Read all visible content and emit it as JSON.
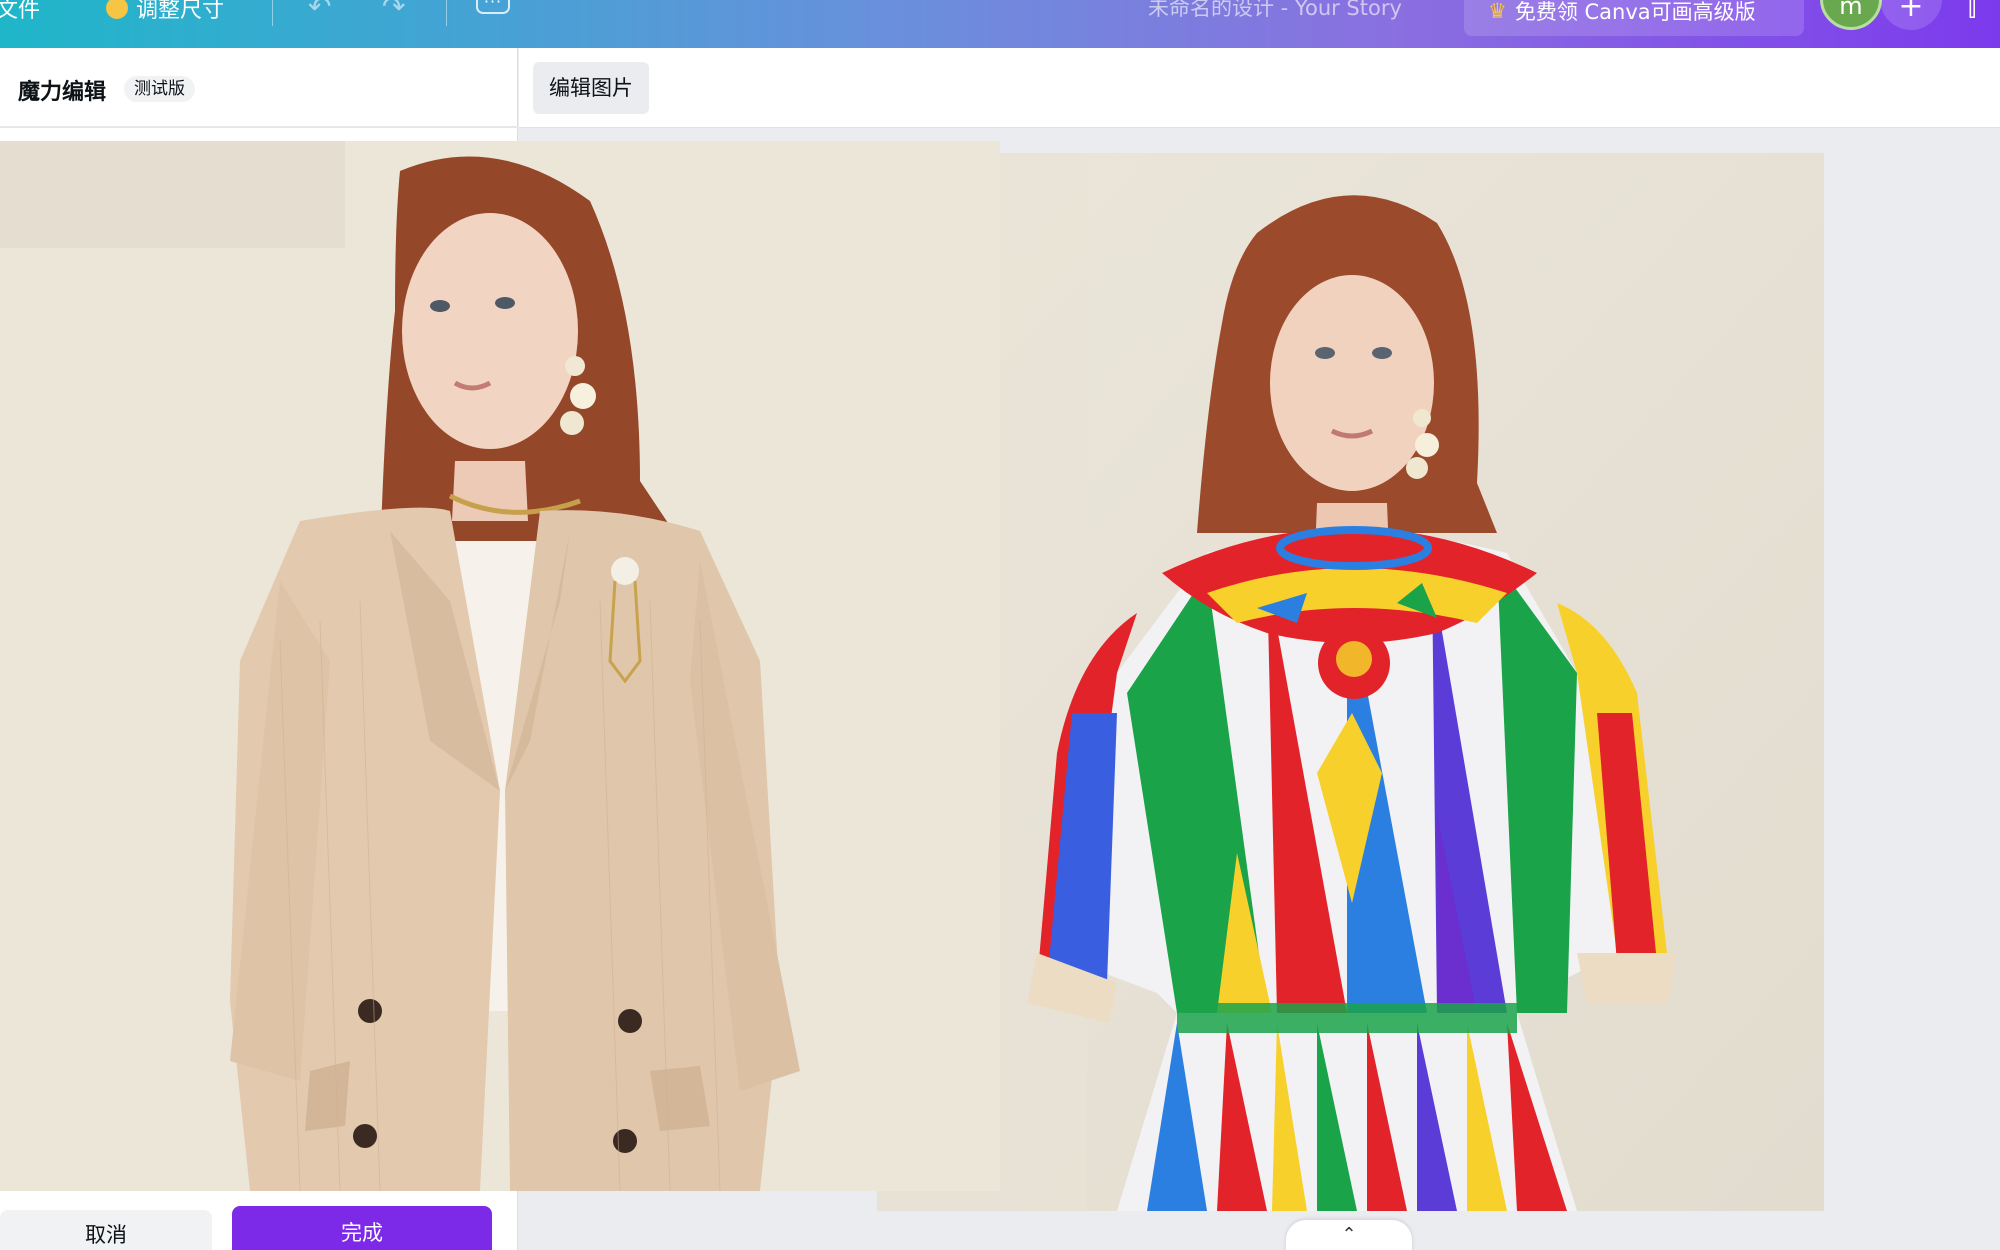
{
  "topbar": {
    "file_label": "文件",
    "resize_label": "调整尺寸",
    "undo_icon": "↶",
    "redo_icon": "↷",
    "more_icon": "···",
    "document_title": "未命名的设计 - Your Story",
    "upgrade_label": "免费领 Canva可画高级版",
    "upgrade_icon": "♛",
    "avatar_initial": "m",
    "plus_icon": "+",
    "share_icon": "⫿"
  },
  "left_panel": {
    "title": "魔力编辑",
    "badge": "测试版",
    "cancel_label": "取消",
    "done_label": "完成"
  },
  "canvas": {
    "edit_image_label": "编辑图片",
    "scroll_handle_icon": "⌃"
  },
  "colors": {
    "brand_purple": "#7d2ae8",
    "background_cream": "#ece5d8"
  }
}
